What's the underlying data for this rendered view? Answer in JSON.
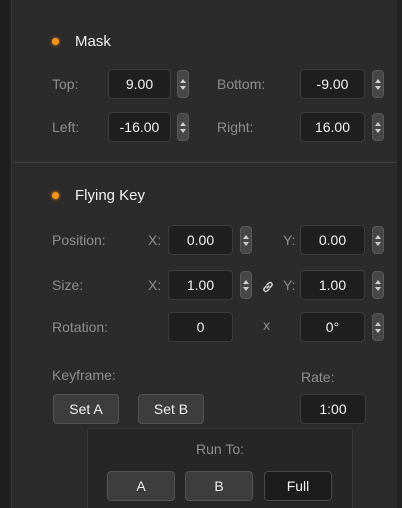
{
  "mask": {
    "title": "Mask",
    "top_label": "Top:",
    "top_value": "9.00",
    "bottom_label": "Bottom:",
    "bottom_value": "-9.00",
    "left_label": "Left:",
    "left_value": "-16.00",
    "right_label": "Right:",
    "right_value": "16.00"
  },
  "flying_key": {
    "title": "Flying Key",
    "position_label": "Position:",
    "size_label": "Size:",
    "rotation_label": "Rotation:",
    "x_label": "X:",
    "y_label": "Y:",
    "x_lower_label": "x",
    "position_x": "0.00",
    "position_y": "0.00",
    "size_x": "1.00",
    "size_y": "1.00",
    "rotation_value": "0",
    "rotation_degrees": "0°"
  },
  "keyframe": {
    "label": "Keyframe:",
    "set_a": "Set A",
    "set_b": "Set B",
    "rate_label": "Rate:",
    "rate_value": "1:00"
  },
  "run_to": {
    "label": "Run To:",
    "a": "A",
    "b": "B",
    "full": "Full"
  },
  "colors": {
    "indicator": "#f7941d",
    "panel": "#2b2b2b",
    "field": "#1f1f1f"
  }
}
